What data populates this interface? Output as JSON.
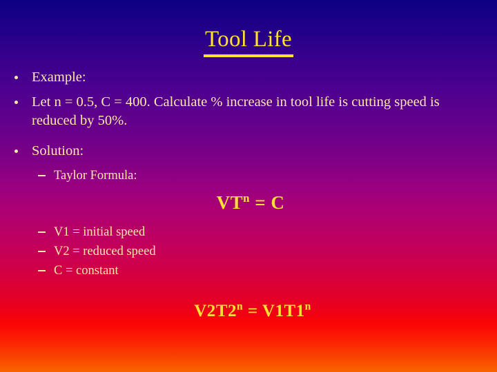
{
  "slide": {
    "title": "Tool Life",
    "title_color": "#ffe033",
    "body_color": "#ffe9a8",
    "background": {
      "type": "vertical-gradient",
      "top_color": "#0d0082",
      "mid_color": "#990080",
      "bottom_color": "#fa6400"
    },
    "bullets": [
      {
        "level": 1,
        "text": "Example:"
      },
      {
        "level": 1,
        "text": "Let n = 0.5, C = 400.  Calculate % increase in tool life is cutting speed is reduced by 50%."
      },
      {
        "level": 1,
        "text": "Solution:"
      },
      {
        "level": 2,
        "text": "Taylor Formula:"
      },
      {
        "level": 2,
        "text": "V1 = initial speed"
      },
      {
        "level": 2,
        "text": "V2 = reduced speed"
      },
      {
        "level": 2,
        "text": "C = constant"
      }
    ],
    "formulas": {
      "taylor": {
        "base1": "VT",
        "sup1": "n",
        "operator": " = ",
        "base2": "C"
      },
      "result": {
        "base1": "V2T2",
        "sup1": "n",
        "operator": " = ",
        "base2": "V1T1",
        "sup2": "n"
      }
    }
  }
}
